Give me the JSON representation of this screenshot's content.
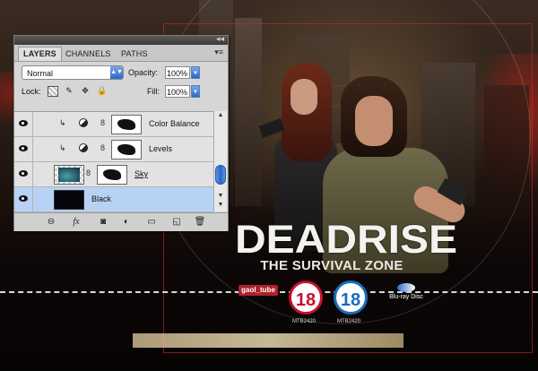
{
  "panel": {
    "tabs": [
      {
        "label": "LAYERS",
        "active": true
      },
      {
        "label": "CHANNELS",
        "active": false
      },
      {
        "label": "PATHS",
        "active": false
      }
    ],
    "blend_mode": "Normal",
    "opacity_label": "Opacity:",
    "opacity_value": "100%",
    "lock_label": "Lock:",
    "fill_label": "Fill:",
    "fill_value": "100%",
    "layers": [
      {
        "name": "Color Balance",
        "clipped": true,
        "type": "adjustment"
      },
      {
        "name": "Levels",
        "clipped": true,
        "type": "adjustment"
      },
      {
        "name": "Sky",
        "clipped": false,
        "type": "image-with-mask"
      },
      {
        "name": "Black",
        "clipped": false,
        "type": "fill",
        "selected": true
      }
    ],
    "footer_icons": [
      "link-icon",
      "fx-icon",
      "mask-icon",
      "adjustment-icon",
      "group-folder-icon",
      "new-layer-icon",
      "trash-icon"
    ]
  },
  "artwork": {
    "title": "DEADRISE",
    "subtitle": "THE SURVIVAL ZONE",
    "logo_text": "gaol_tube",
    "rating_left": "18",
    "rating_right": "18",
    "rating_left_code": "MTB2420",
    "rating_right_code": "MTB2420",
    "format_logo": "Blu-ray Disc"
  },
  "colors": {
    "panel_bg": "#d6d6d6",
    "selected_layer": "#b7d2f5",
    "accent_blue": "#2b67c9",
    "bbfc_red": "#c8102e",
    "ifco_blue": "#1a6cbc"
  }
}
